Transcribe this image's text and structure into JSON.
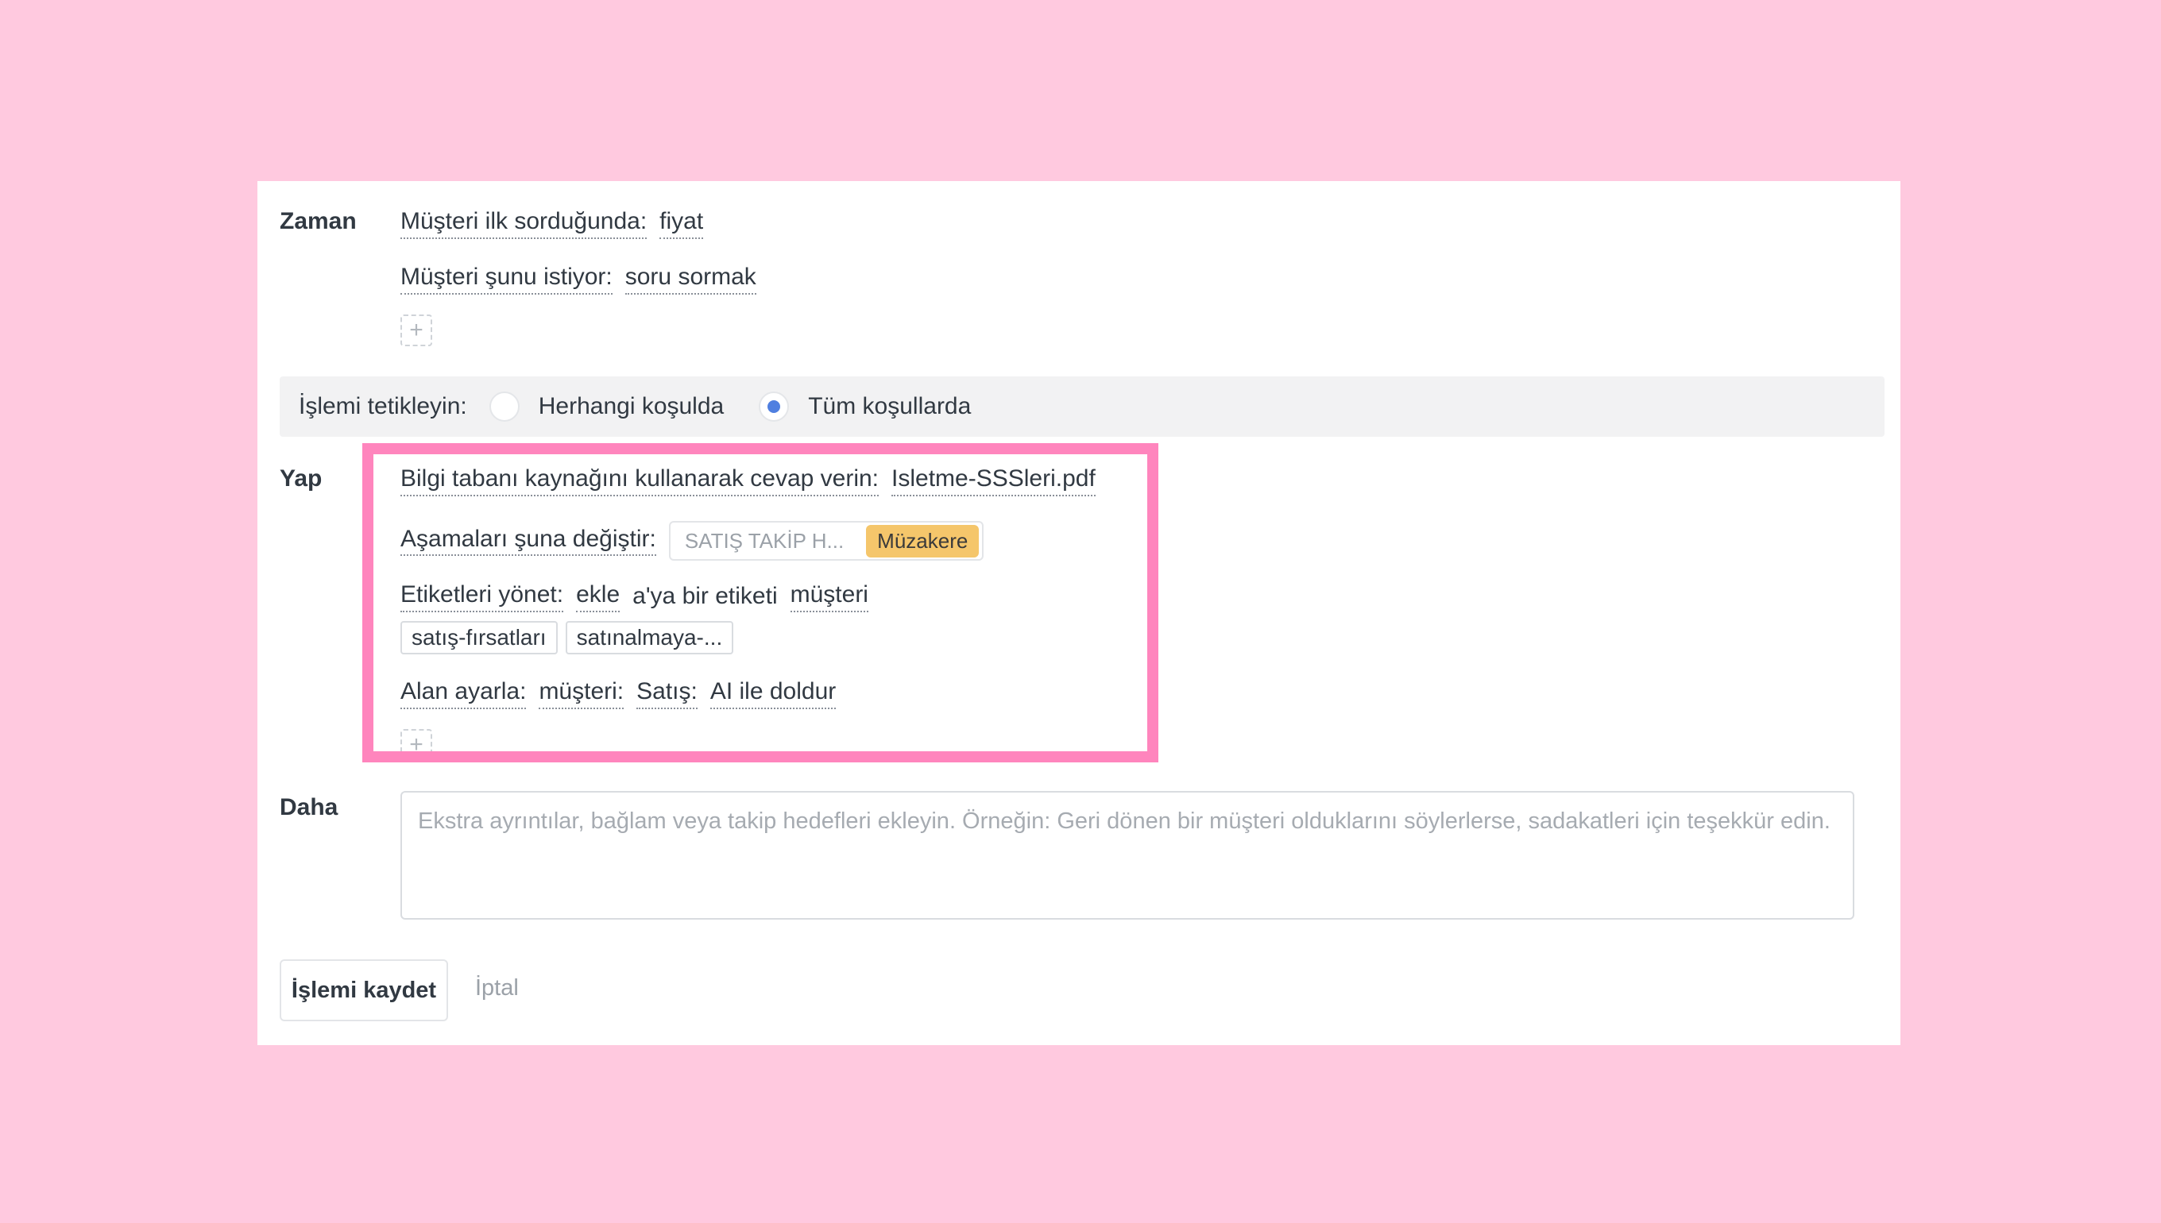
{
  "when": {
    "label": "Zaman",
    "conditions": [
      {
        "key": "Müşteri ilk sorduğunda:",
        "value": "fiyat"
      },
      {
        "key": "Müşteri şunu istiyor:",
        "value": "soru sormak"
      }
    ],
    "add_symbol": "+"
  },
  "trigger": {
    "label": "İşlemi tetikleyin:",
    "options": [
      {
        "label": "Herhangi koşulda",
        "selected": false
      },
      {
        "label": "Tüm koşullarda",
        "selected": true
      }
    ]
  },
  "do": {
    "label": "Yap",
    "kb": {
      "key": "Bilgi tabanı kaynağını kullanarak cevap verin:",
      "value": "Isletme-SSSleri.pdf"
    },
    "stage": {
      "key": "Aşamaları şuna değiştir:",
      "pipeline": "SATIŞ TAKİP H...",
      "stage": "Müzakere"
    },
    "tags": {
      "key": "Etiketleri yönet:",
      "action": "ekle",
      "connector": "a'ya bir etiketi",
      "target": "müşteri",
      "chips": [
        "satış-fırsatları",
        "satınalmaya-..."
      ]
    },
    "field": {
      "key": "Alan ayarla:",
      "entity": "müşteri:",
      "field": "Satış:",
      "value": "AI ile doldur"
    },
    "add_symbol": "+"
  },
  "more": {
    "label": "Daha",
    "placeholder": "Ekstra ayrıntılar, bağlam veya takip hedefleri ekleyin. Örneğin: Geri dönen bir müşteri olduklarını söylerlerse, sadakatleri için teşekkür edin."
  },
  "footer": {
    "save": "İşlemi kaydet",
    "cancel": "İptal"
  },
  "colors": {
    "background": "#ffc9df",
    "highlight": "#ff85bd",
    "radio_selected": "#4f7fe0",
    "stage_badge": "#f5c66b"
  }
}
